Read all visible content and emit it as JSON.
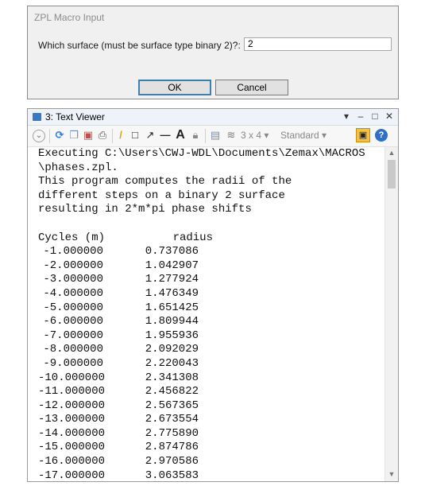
{
  "dialog": {
    "title": "ZPL Macro Input",
    "prompt": "Which surface (must be surface type binary 2)?:",
    "input_value": "2",
    "ok_label": "OK",
    "cancel_label": "Cancel"
  },
  "viewer": {
    "title": "3: Text Viewer",
    "controls": {
      "dropdown": "▾",
      "minimize": "–",
      "maximize": "□",
      "close": "✕"
    },
    "toolbar": {
      "grid_label": "3 x 4 ▾",
      "standard_label": "Standard ▾"
    },
    "text_lines": [
      "Executing C:\\Users\\CWJ-WDL\\Documents\\Zemax\\MACROS",
      "\\phases.zpl.",
      "This program computes the radii of the",
      "different steps on a binary 2 surface",
      "resulting in 2*m*pi phase shifts"
    ],
    "table_header": {
      "cycles": "Cycles (m)",
      "radius": "radius"
    },
    "rows": [
      {
        "cycle": "-1.000000",
        "radius": "0.737086"
      },
      {
        "cycle": "-2.000000",
        "radius": "1.042907"
      },
      {
        "cycle": "-3.000000",
        "radius": "1.277924"
      },
      {
        "cycle": "-4.000000",
        "radius": "1.476349"
      },
      {
        "cycle": "-5.000000",
        "radius": "1.651425"
      },
      {
        "cycle": "-6.000000",
        "radius": "1.809944"
      },
      {
        "cycle": "-7.000000",
        "radius": "1.955936"
      },
      {
        "cycle": "-8.000000",
        "radius": "2.092029"
      },
      {
        "cycle": "-9.000000",
        "radius": "2.220043"
      },
      {
        "cycle": "-10.000000",
        "radius": "2.341308"
      },
      {
        "cycle": "-11.000000",
        "radius": "2.456822"
      },
      {
        "cycle": "-12.000000",
        "radius": "2.567365"
      },
      {
        "cycle": "-13.000000",
        "radius": "2.673554"
      },
      {
        "cycle": "-14.000000",
        "radius": "2.775890"
      },
      {
        "cycle": "-15.000000",
        "radius": "2.874786"
      },
      {
        "cycle": "-16.000000",
        "radius": "2.970586"
      },
      {
        "cycle": "-17.000000",
        "radius": "3.063583"
      }
    ]
  }
}
